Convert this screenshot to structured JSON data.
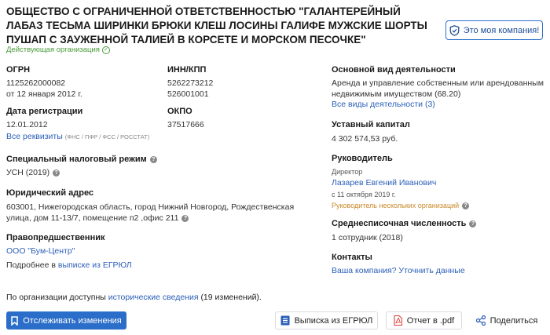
{
  "company": {
    "title": "ОБЩЕСТВО С ОГРАНИЧЕННОЙ ОТВЕТСТВЕННОСТЬЮ \"ГАЛАНТЕРЕЙНЫЙ ЛАБАЗ ТЕСЬМА ШИРИНКИ БРЮКИ КЛЕШ ЛОСИНЫ ГАЛИФЕ МУЖСКИЕ ШОРТЫ ПУШАП С ЗАУЖЕННОЙ ТАЛИЕЙ В КОРСЕТЕ И МОРСКОМ ПЕСОЧКЕ\"",
    "status": "Действующая организация",
    "my_company_button": "Это моя компания!"
  },
  "ogrn": {
    "label": "ОГРН",
    "value": "1125262000082",
    "date": "от 12 января 2012 г."
  },
  "inn": {
    "label": "ИНН/КПП",
    "inn": "5262273212",
    "kpp": "526001001"
  },
  "okved": {
    "label": "Основной вид деятельности",
    "text": "Аренда и управление собственным или арендованным недвижимым имуществом",
    "code": "(68.20)",
    "all_link": "Все виды деятельности (3)"
  },
  "registration": {
    "label": "Дата регистрации",
    "value": "12.01.2012",
    "all_link": "Все реквизиты",
    "sources": "(ФНС / ПФР / ФСС / РОССТАТ)"
  },
  "okpo": {
    "label": "ОКПО",
    "value": "37517666"
  },
  "capital": {
    "label": "Уставный капитал",
    "value": "4 302 574,53 руб."
  },
  "tax": {
    "label": "Специальный налоговый режим",
    "value": "УСН (2019)"
  },
  "head": {
    "label": "Руководитель",
    "role": "Директор",
    "name": "Лазарев Евгений Иванович",
    "since": "с 11 октября 2019 г.",
    "note": "Руководитель нескольких организаций"
  },
  "address": {
    "label": "Юридический адрес",
    "line1": "603001, Нижегородская область, город Нижний Новгород, Рождественская",
    "line2": "улица, дом 11-13/7, помещение п2 ,офис 211"
  },
  "employees": {
    "label": "Среднесписочная численность",
    "value": "1 сотрудник (2018)"
  },
  "predecessor": {
    "label": "Правопредшественник",
    "name": "ООО \"Бум-Центр\"",
    "more_prefix": "Подробнее в",
    "more_link": "выписке из ЕГРЮЛ"
  },
  "contacts": {
    "label": "Контакты",
    "link": "Ваша компания? Уточнить данные"
  },
  "history": {
    "prefix": "По организации доступны",
    "link": "исторические сведения",
    "suffix": "(19 изменений)."
  },
  "actions": {
    "track": "Отслеживать изменения",
    "egrul": "Выписка из ЕГРЮЛ",
    "pdf": "Отчет в .pdf",
    "share": "Поделиться"
  },
  "colors": {
    "accent": "#2b6ec9",
    "link": "#2b5fb8",
    "ok": "#4a9a3a",
    "warn": "#c98a2a"
  }
}
